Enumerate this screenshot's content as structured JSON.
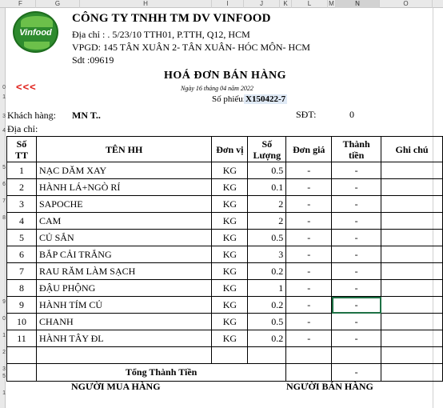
{
  "spreadsheet": {
    "columns": [
      "F",
      "G",
      "H",
      "I",
      "J",
      "K",
      "L",
      "M",
      "N",
      "O"
    ],
    "selected_column": "N",
    "row_numbers": [
      "0",
      "1",
      "2",
      "3",
      "4",
      "5",
      "6",
      "7",
      "8",
      "9",
      "0",
      "1",
      "2",
      "3",
      "4",
      "5",
      "1"
    ]
  },
  "header": {
    "logo_text": "Vinfood",
    "company_name": "CÔNG TY TNHH TM DV VINFOOD",
    "address": "Địa chỉ : . 5/23/10 TTH01, P.TTH, Q12, HCM",
    "office": "VPGD: 145 TÂN XUÂN 2- TÂN XUÂN- HÓC MÔN- HCM",
    "phone": "Sdt :09619"
  },
  "nav": {
    "back_link": "<<<"
  },
  "invoice": {
    "title": "HOÁ ĐƠN BÁN HÀNG",
    "date": "Ngày 16 tháng 04 năm 2022",
    "number_label": "Số phiếu:",
    "number": "X150422-7"
  },
  "customer": {
    "name_label": "Khách hàng:",
    "name_value": "MN T..",
    "phone_label": "SĐT:",
    "phone_value": "0",
    "address_label": "Địa chỉ:"
  },
  "table": {
    "headers": {
      "stt": "Số TT",
      "name": "TÊN HH",
      "unit": "Đơn vị",
      "qty": "Số Lượng",
      "price": "Đơn giá",
      "amount": "Thành tiền",
      "note": "Ghi chú"
    },
    "rows": [
      {
        "stt": "1",
        "name": "NẠC DĂM XAY",
        "unit": "KG",
        "qty": "0.5",
        "price": "-",
        "amount": "-"
      },
      {
        "stt": "2",
        "name": "HÀNH LÁ+NGÒ RÍ",
        "unit": "KG",
        "qty": "0.1",
        "price": "-",
        "amount": "-"
      },
      {
        "stt": "3",
        "name": "SAPOCHE",
        "unit": "KG",
        "qty": "2",
        "price": "-",
        "amount": "-"
      },
      {
        "stt": "4",
        "name": "CAM",
        "unit": "KG",
        "qty": "2",
        "price": "-",
        "amount": "-"
      },
      {
        "stt": "5",
        "name": "CỦ SẮN",
        "unit": "KG",
        "qty": "0.5",
        "price": "-",
        "amount": "-"
      },
      {
        "stt": "6",
        "name": "BẮP CẢI TRẮNG",
        "unit": "KG",
        "qty": "3",
        "price": "-",
        "amount": "-"
      },
      {
        "stt": "7",
        "name": "RAU RĂM LÀM SẠCH",
        "unit": "KG",
        "qty": "0.2",
        "price": "-",
        "amount": "-"
      },
      {
        "stt": "8",
        "name": "ĐẬU PHỘNG",
        "unit": "KG",
        "qty": "1",
        "price": "-",
        "amount": "-"
      },
      {
        "stt": "9",
        "name": "HÀNH TÍM CỦ",
        "unit": "KG",
        "qty": "0.2",
        "price": "-",
        "amount": "-"
      },
      {
        "stt": "10",
        "name": "CHANH",
        "unit": "KG",
        "qty": "0.5",
        "price": "-",
        "amount": "-"
      },
      {
        "stt": "11",
        "name": "HÀNH TÂY ĐL",
        "unit": "KG",
        "qty": "0.2",
        "price": "-",
        "amount": "-"
      }
    ],
    "total_label": "Tổng Thành Tiền",
    "total_value": "-"
  },
  "signatures": {
    "buyer": "NGƯỜI MUA HÀNG",
    "seller": "NGƯỜI BÁN HÀNG"
  },
  "colors": {
    "back_link": "#e0201b",
    "logo_green": "#2e8b2e",
    "selection": "#1e7145"
  }
}
